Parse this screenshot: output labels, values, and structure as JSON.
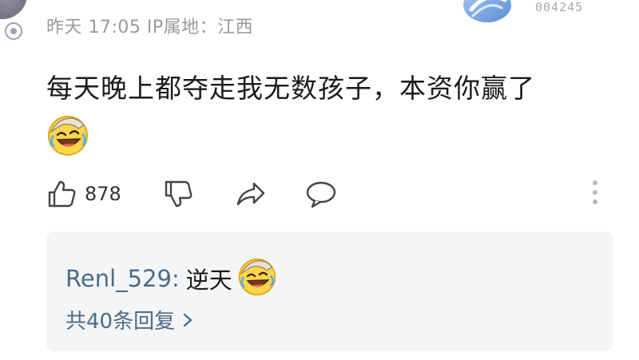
{
  "comment": {
    "meta": "昨天 17:05 IP属地：江西",
    "medal_count": "004245",
    "text": "每天晚上都夺走我无数孩子，本资你赢了",
    "emoji": "laughing-crying-emoji"
  },
  "actions": {
    "like_icon": "thumbs-up-icon",
    "like_count": "878",
    "dislike_icon": "thumbs-down-icon",
    "share_icon": "share-arrow-icon",
    "reply_icon": "comment-bubble-icon",
    "more_icon": "more-vertical-icon"
  },
  "reply_preview": {
    "username": "Renl_529:",
    "content": "逆天",
    "emoji": "laughing-crying-emoji",
    "view_all": "共40条回复",
    "view_all_icon": "chevron-right-icon"
  },
  "colors": {
    "meta_text": "#9a9a9a",
    "body_text": "#1a1a1a",
    "link_blue": "#4c6c88",
    "reply_bg": "#f4f5f7",
    "icon_gray": "#444444"
  }
}
